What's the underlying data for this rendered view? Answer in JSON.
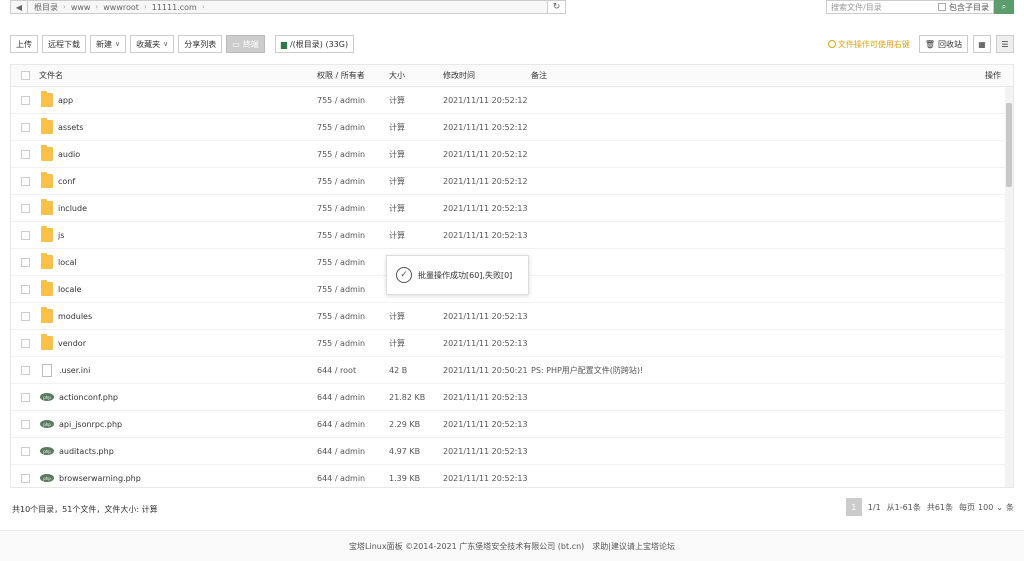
{
  "pathbar": {
    "back_icon": "arrow-left-icon",
    "segments": [
      "根目录",
      "www",
      "wwwroot",
      "11111.com"
    ],
    "refresh_icon": "refresh-icon",
    "search_placeholder": "搜索文件/目录",
    "include_sub_label": "包含子目录"
  },
  "toolbar": {
    "upload": "上传",
    "remote_download": "远程下载",
    "new": "新建",
    "favorites": "收藏夹",
    "share_list": "分享列表",
    "terminal": "终端",
    "disk": "/(根目录) (33G)",
    "tip": "文件操作可使用右键",
    "recycle": "回收站"
  },
  "table": {
    "headers": {
      "name": "文件名",
      "perm": "权限 / 所有者",
      "size": "大小",
      "time": "修改时间",
      "note": "备注",
      "op": "操作"
    },
    "rows": [
      {
        "type": "folder",
        "name": "app",
        "perm": "755 / admin",
        "size": "计算",
        "time": "2021/11/11 20:52:12",
        "note": ""
      },
      {
        "type": "folder",
        "name": "assets",
        "perm": "755 / admin",
        "size": "计算",
        "time": "2021/11/11 20:52:12",
        "note": ""
      },
      {
        "type": "folder",
        "name": "audio",
        "perm": "755 / admin",
        "size": "计算",
        "time": "2021/11/11 20:52:12",
        "note": ""
      },
      {
        "type": "folder",
        "name": "conf",
        "perm": "755 / admin",
        "size": "计算",
        "time": "2021/11/11 20:52:12",
        "note": ""
      },
      {
        "type": "folder",
        "name": "include",
        "perm": "755 / admin",
        "size": "计算",
        "time": "2021/11/11 20:52:13",
        "note": ""
      },
      {
        "type": "folder",
        "name": "js",
        "perm": "755 / admin",
        "size": "计算",
        "time": "2021/11/11 20:52:13",
        "note": ""
      },
      {
        "type": "folder",
        "name": "local",
        "perm": "755 / admin",
        "size": "",
        "time": "",
        "note": ""
      },
      {
        "type": "folder",
        "name": "locale",
        "perm": "755 / admin",
        "size": "",
        "time": "",
        "note": ""
      },
      {
        "type": "folder",
        "name": "modules",
        "perm": "755 / admin",
        "size": "计算",
        "time": "2021/11/11 20:52:13",
        "note": ""
      },
      {
        "type": "folder",
        "name": "vendor",
        "perm": "755 / admin",
        "size": "计算",
        "time": "2021/11/11 20:52:13",
        "note": ""
      },
      {
        "type": "ini",
        "name": ".user.ini",
        "perm": "644 / root",
        "size": "42 B",
        "time": "2021/11/11 20:50:21",
        "note": "PS: PHP用户配置文件(防跨站)!"
      },
      {
        "type": "php",
        "name": "actionconf.php",
        "perm": "644 / admin",
        "size": "21.82 KB",
        "time": "2021/11/11 20:52:13",
        "note": ""
      },
      {
        "type": "php",
        "name": "api_jsonrpc.php",
        "perm": "644 / admin",
        "size": "2.29 KB",
        "time": "2021/11/11 20:52:13",
        "note": ""
      },
      {
        "type": "php",
        "name": "auditacts.php",
        "perm": "644 / admin",
        "size": "4.97 KB",
        "time": "2021/11/11 20:52:13",
        "note": ""
      },
      {
        "type": "php",
        "name": "browserwarning.php",
        "perm": "644 / admin",
        "size": "1.39 KB",
        "time": "2021/11/11 20:52:13",
        "note": ""
      }
    ]
  },
  "toast": {
    "text": "批量操作成功[60],失败[0]"
  },
  "summary": "共10个目录，51个文件，文件大小: 计算",
  "pager": {
    "current": "1",
    "pages": "1/1",
    "range": "从1-61条",
    "total": "共61条",
    "per_page_label": "每页",
    "per_page": "100",
    "unit": "条"
  },
  "footer": {
    "copyright": "宝塔Linux面板 ©2014-2021 广东堡塔安全技术有限公司 (bt.cn)",
    "help": "求助|建议请上宝塔论坛"
  }
}
